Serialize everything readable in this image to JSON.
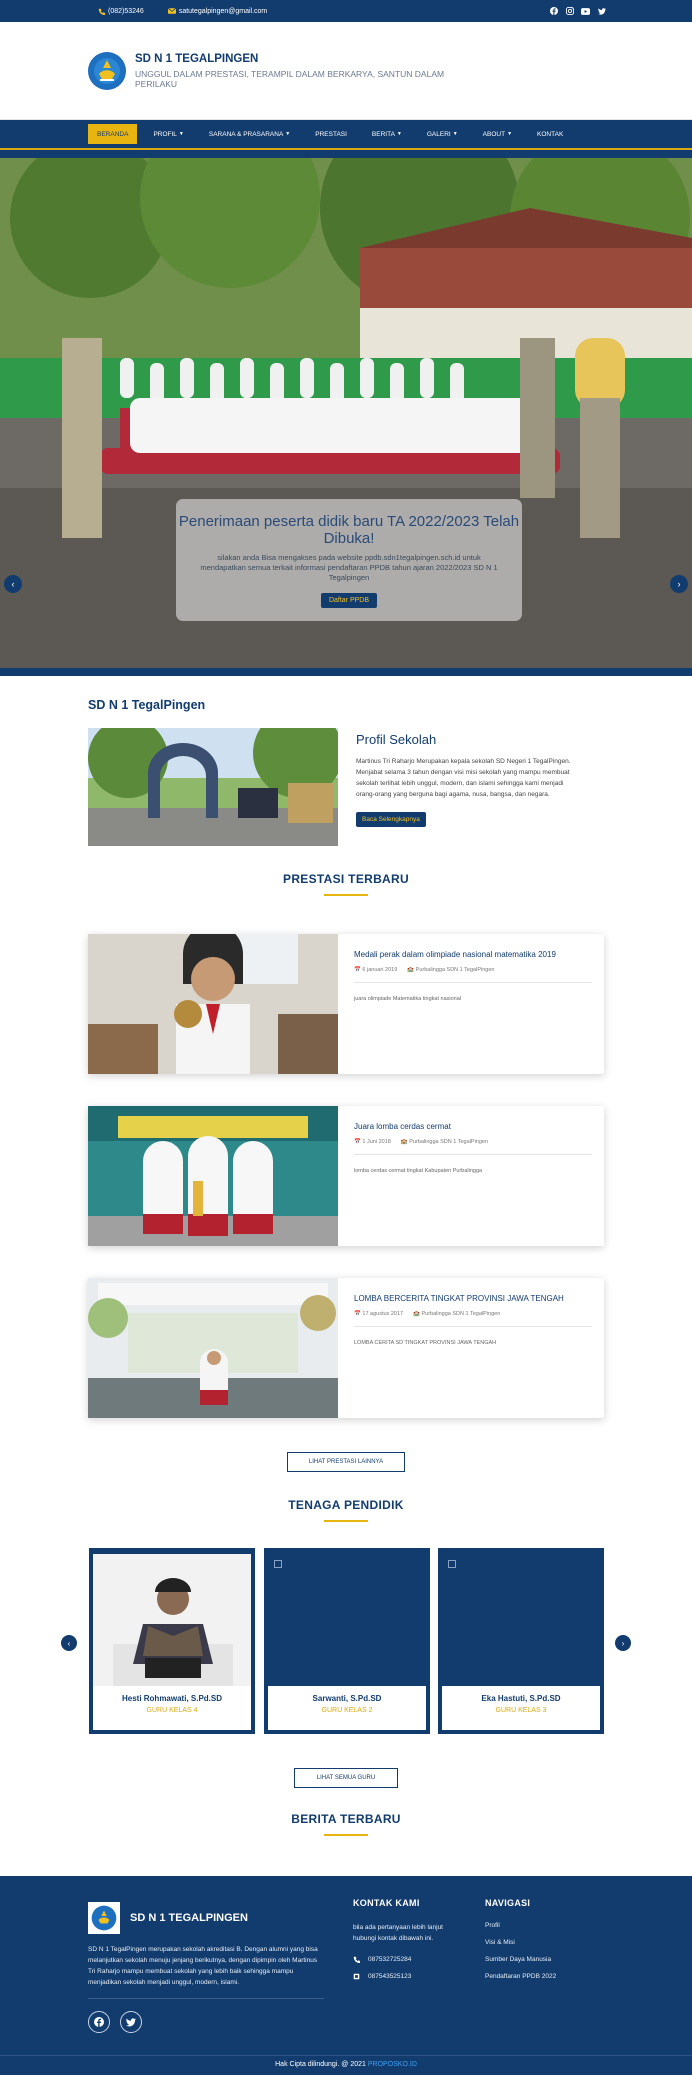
{
  "topbar": {
    "phone": "(082)53246",
    "email": "satutegalpingen@gmail.com"
  },
  "header": {
    "school_name": "SD N 1 TEGALPINGEN",
    "tagline": "UNGGUL DALAM PRESTASI, TERAMPIL DALAM BERKARYA, SANTUN DALAM PERILAKU"
  },
  "nav": {
    "items": [
      "BERANDA",
      "PROFIL",
      "SARANA & PRASARANA",
      "PRESTASI",
      "BERITA",
      "GALERI",
      "ABOUT",
      "KONTAK"
    ]
  },
  "hero": {
    "title": "Penerimaan peserta didik baru TA 2022/2023 Telah Dibuka!",
    "text": "silakan anda Bisa mengakses pada website ppdb.sdn1tegalpingen.sch.id untuk mendapatkan semua terkait informasi pendaftaran PPDB tahun ajaran 2022/2023 SD N 1 Tegalpingen",
    "button": "Daftar PPDB",
    "prev": "‹",
    "next": "›"
  },
  "about": {
    "section_title": "SD N 1 TegalPingen",
    "heading": "Profil Sekolah",
    "text": "Martinus Tri Raharjo Merupakan kepala sekolah SD Negeri 1 TegalPingen. Menjabat selama 3 tahun dengan visi misi sekolah yang mampu membuat sekolah terlihat lebih unggul, modern, dan islami sehingga kami menjadi orang-orang yang berguna bagi agama, nusa, bangsa, dan negara.",
    "button": "Baca Selengkapnya"
  },
  "prestasi": {
    "title": "PRESTASI TERBARU",
    "items": [
      {
        "title": "Medali perak dalam olimpiade nasional matematika 2019",
        "date": "6 januari 2019",
        "place": "Purbalingga SDN 1 TegalPingen",
        "excerpt": "juara olimpiade Matematika tingkat nasional"
      },
      {
        "title": "Juara lomba cerdas cermat",
        "date": "1 Juni 2018",
        "place": "Purbalingga SDN 1 TegalPingen",
        "excerpt": "lomba cerdas cermat tingkat Kabupaten Purbalingga"
      },
      {
        "title": "LOMBA BERCERITA TINGKAT PROVINSI JAWA TENGAH",
        "date": "17 agustus 2017",
        "place": "Purbalingga SDN 1 TegalPingen",
        "excerpt": "LOMBA CERITA SD TINGKAT PROVINSI JAWA TENGAH"
      }
    ],
    "more": "LIHAT PRESTASI LAINNYA"
  },
  "guru": {
    "title": "TENAGA PENDIDIK",
    "items": [
      {
        "name": "Hesti Rohmawati, S.Pd.SD",
        "role": "GURU KELAS 4"
      },
      {
        "name": "Sarwanti, S.Pd.SD",
        "role": "GURU KELAS 2"
      },
      {
        "name": "Eka Hastuti, S.Pd.SD",
        "role": "GURU KELAS 3"
      }
    ],
    "more": "LIHAT SEMUA GURU"
  },
  "berita": {
    "title": "BERITA TERBARU"
  },
  "footer": {
    "name": "SD N 1 TEGALPINGEN",
    "desc": "SD N 1 TegalPingen merupakan sekolah akreditasi B. Dengan alumni yang bisa melanjutkan sekolah menuju jenjang berikutnya, dengan dipimpin oleh Martinus Tri Raharjo mampu membuat sekolah yang lebih baik sehingga mampu menjadikan sekolah menjadi unggul, modern, islami.",
    "contact_title": "KONTAK KAMI",
    "contact_text": "bila ada pertanyaan lebih lanjut hubungi kontak dibawah ini.",
    "phone1": "087532725284",
    "phone2": "087543525123",
    "nav_title": "NAVIGASI",
    "nav_links": [
      "Profil",
      "Visi & Misi",
      "Sumber Daya Manusia",
      "Pendaftaran PPDB 2022"
    ],
    "copyright": "Hak Cipta dilindungi. @ 2021",
    "copyright_brand": "PROPOSKO.ID"
  },
  "colors": {
    "primary": "#123c6e",
    "accent": "#e8b510",
    "link": "#3aa0f0"
  }
}
